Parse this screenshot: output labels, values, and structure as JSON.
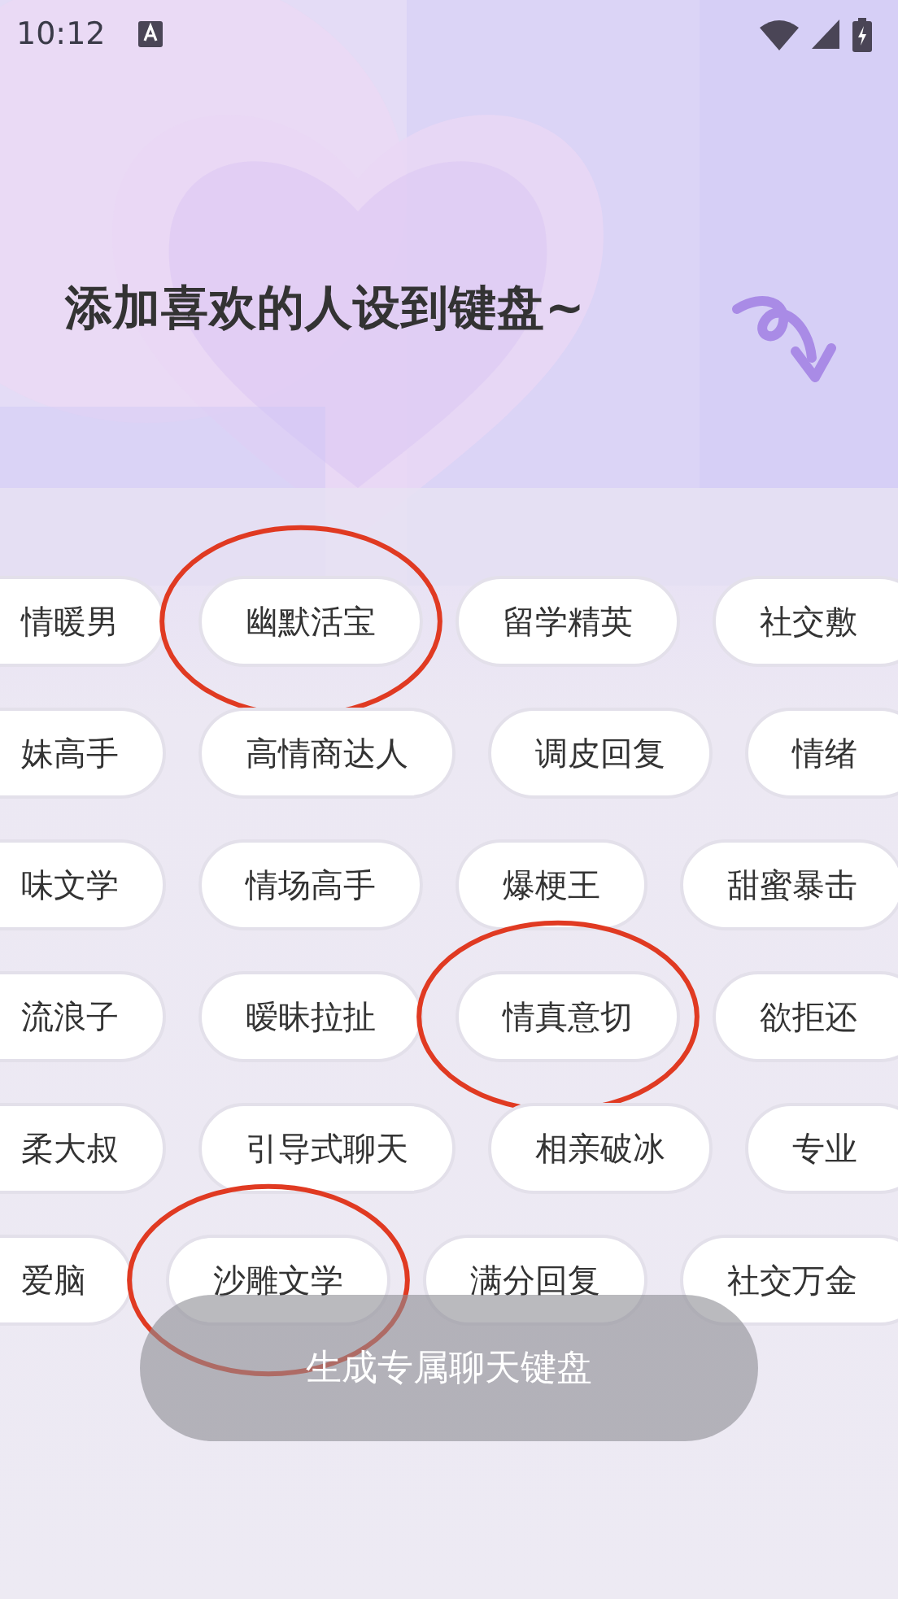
{
  "status_bar": {
    "time": "10:12"
  },
  "title": "添加喜欢的人设到键盘~",
  "tag_rows": [
    [
      {
        "label": "情暖男",
        "kind": "cut_left",
        "circled": false
      },
      {
        "label": "幽默活宝",
        "kind": "whole",
        "circled": true
      },
      {
        "label": "留学精英",
        "kind": "whole",
        "circled": false
      },
      {
        "label": "社交敷",
        "kind": "cut_right",
        "circled": false
      }
    ],
    [
      {
        "label": "妹高手",
        "kind": "cut_left",
        "circled": false
      },
      {
        "label": "高情商达人",
        "kind": "whole",
        "circled": false
      },
      {
        "label": "调皮回复",
        "kind": "whole",
        "circled": false
      },
      {
        "label": "情绪",
        "kind": "cut_right",
        "circled": false
      }
    ],
    [
      {
        "label": "味文学",
        "kind": "cut_left",
        "circled": false
      },
      {
        "label": "情场高手",
        "kind": "whole",
        "circled": false
      },
      {
        "label": "爆梗王",
        "kind": "whole",
        "circled": false
      },
      {
        "label": "甜蜜暴击",
        "kind": "whole",
        "circled": false
      }
    ],
    [
      {
        "label": "流浪子",
        "kind": "cut_left",
        "circled": false
      },
      {
        "label": "暧昧拉扯",
        "kind": "whole",
        "circled": false
      },
      {
        "label": "情真意切",
        "kind": "whole",
        "circled": true
      },
      {
        "label": "欲拒还",
        "kind": "cut_right",
        "circled": false
      }
    ],
    [
      {
        "label": "柔大叔",
        "kind": "cut_left",
        "circled": false
      },
      {
        "label": "引导式聊天",
        "kind": "whole",
        "circled": false
      },
      {
        "label": "相亲破冰",
        "kind": "whole",
        "circled": false
      },
      {
        "label": "专业",
        "kind": "cut_right",
        "circled": false
      }
    ],
    [
      {
        "label": "爱脑",
        "kind": "cut_left",
        "circled": false
      },
      {
        "label": "沙雕文学",
        "kind": "whole",
        "circled": true
      },
      {
        "label": "满分回复",
        "kind": "whole",
        "circled": false
      },
      {
        "label": "社交万金",
        "kind": "cut_right",
        "circled": false
      }
    ]
  ],
  "generate_button": {
    "label": "生成专属聊天键盘"
  }
}
